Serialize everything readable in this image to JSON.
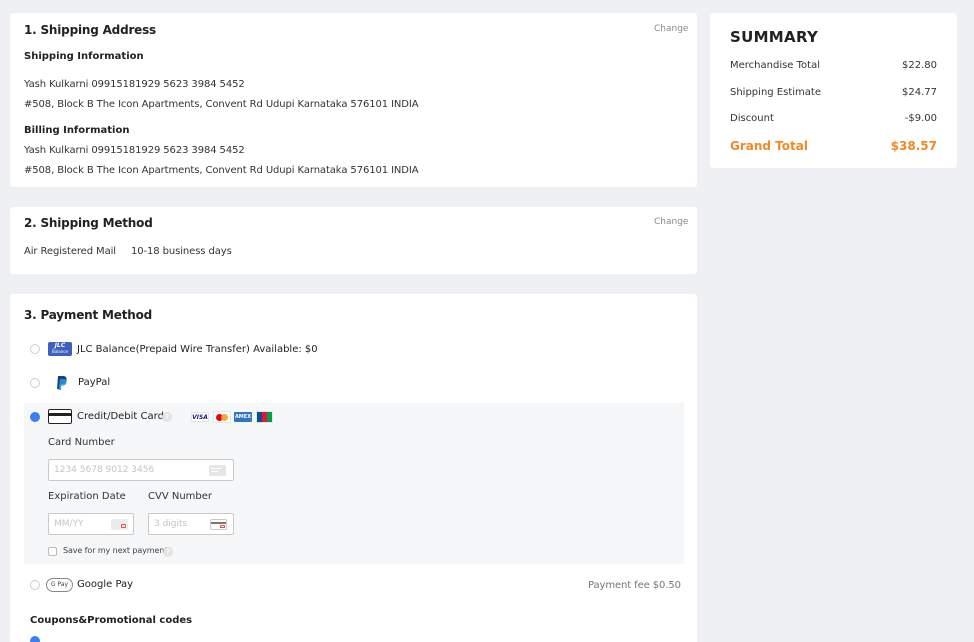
{
  "shipping_address": {
    "title": "1. Shipping Address",
    "change_label": "Change",
    "shipping_info_heading": "Shipping Information",
    "shipping_contact": "Yash Kulkarni 09915181929 5623 3984 5452",
    "shipping_address": "#508, Block B The Icon Apartments, Convent Rd Udupi Karnataka 576101 INDIA",
    "billing_info_heading": "Billing Information",
    "billing_contact": "Yash Kulkarni 09915181929 5623 3984 5452",
    "billing_address": "#508, Block B The Icon Apartments, Convent Rd Udupi Karnataka 576101 INDIA"
  },
  "shipping_method": {
    "title": "2. Shipping Method",
    "change_label": "Change",
    "method": "Air Registered Mail",
    "duration": "10-18 business days"
  },
  "payment_method": {
    "title": "3. Payment Method",
    "options": [
      {
        "label": "JLC Balance(Prepaid Wire Transfer) Available: $0",
        "icon": "jlc-balance-icon",
        "selected": false
      },
      {
        "label": "PayPal",
        "icon": "paypal-icon",
        "selected": false
      },
      {
        "label": "Credit/Debit Card",
        "icon": "credit-card-icon",
        "selected": true
      },
      {
        "label": "Google Pay",
        "icon": "google-pay-icon",
        "selected": false
      }
    ],
    "card_brands": [
      "VISA",
      "Mastercard",
      "Amex",
      "JCB"
    ],
    "jlc_logo_text": "JLC",
    "jlc_logo_subtext": "Balance",
    "gpay_logo_text": "G Pay",
    "visa_logo_text": "VISA",
    "amex_logo_text": "AMEX",
    "card_number_label": "Card Number",
    "card_number_placeholder": "1234 5678 9012 3456",
    "expiration_label": "Expiration Date",
    "expiration_placeholder": "MM/YY",
    "cvv_label": "CVV Number",
    "cvv_placeholder": "3 digits",
    "save_label": "Save for my next payment",
    "google_pay_fee": "Payment fee $0.50",
    "coupons_heading": "Coupons&Promotional codes"
  },
  "summary": {
    "title": "SUMMARY",
    "rows": [
      {
        "label": "Merchandise Total",
        "value": "$22.80"
      },
      {
        "label": "Shipping Estimate",
        "value": "$24.77"
      },
      {
        "label": "Discount",
        "value": "-$9.00"
      }
    ],
    "grand_label": "Grand Total",
    "grand_value": "$38.57"
  },
  "colors": {
    "accent_orange": "#f08a24",
    "radio_blue": "#3d7ff0",
    "page_bg": "#eef0f4"
  }
}
